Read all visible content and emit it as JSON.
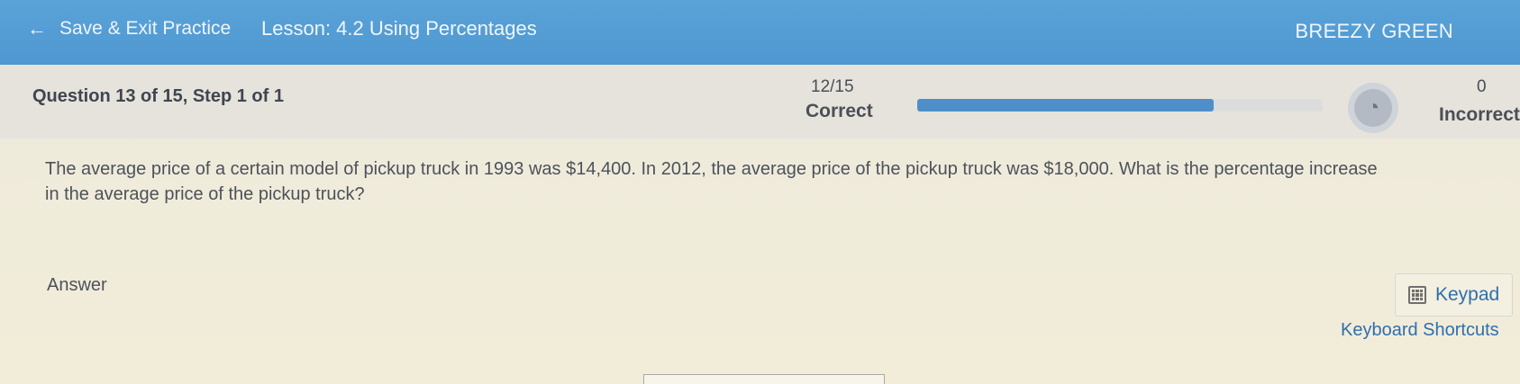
{
  "header": {
    "back_label": "Save & Exit Practice",
    "lesson_title": "Lesson: 4.2 Using Percentages",
    "user_name": "BREEZY GREEN"
  },
  "status": {
    "question_label": "Question 13 of 15,  Step 1 of 1",
    "correct_count": "12/15",
    "correct_label": "Correct",
    "progress_fraction": 0.73,
    "incorrect_count": "0",
    "incorrect_label": "Incorrect"
  },
  "question": {
    "line1": "The average price of a certain model of pickup truck in 1993 was $14,400. In 2012, the average price of the pickup truck was $18,000. What is the percentage increase",
    "line2": "in the average price of the pickup truck?"
  },
  "answer": {
    "label": "Answer",
    "value": ""
  },
  "tools": {
    "keypad_label": "Keypad",
    "shortcuts_label": "Keyboard Shortcuts"
  },
  "colors": {
    "header_bg": "#5aa3d9",
    "progress_fill": "#4f8fc9",
    "link": "#2f6fab"
  },
  "icons": {
    "back": "arrow-left-icon",
    "avatar": "player-avatar-icon",
    "keypad": "calculator-icon"
  }
}
